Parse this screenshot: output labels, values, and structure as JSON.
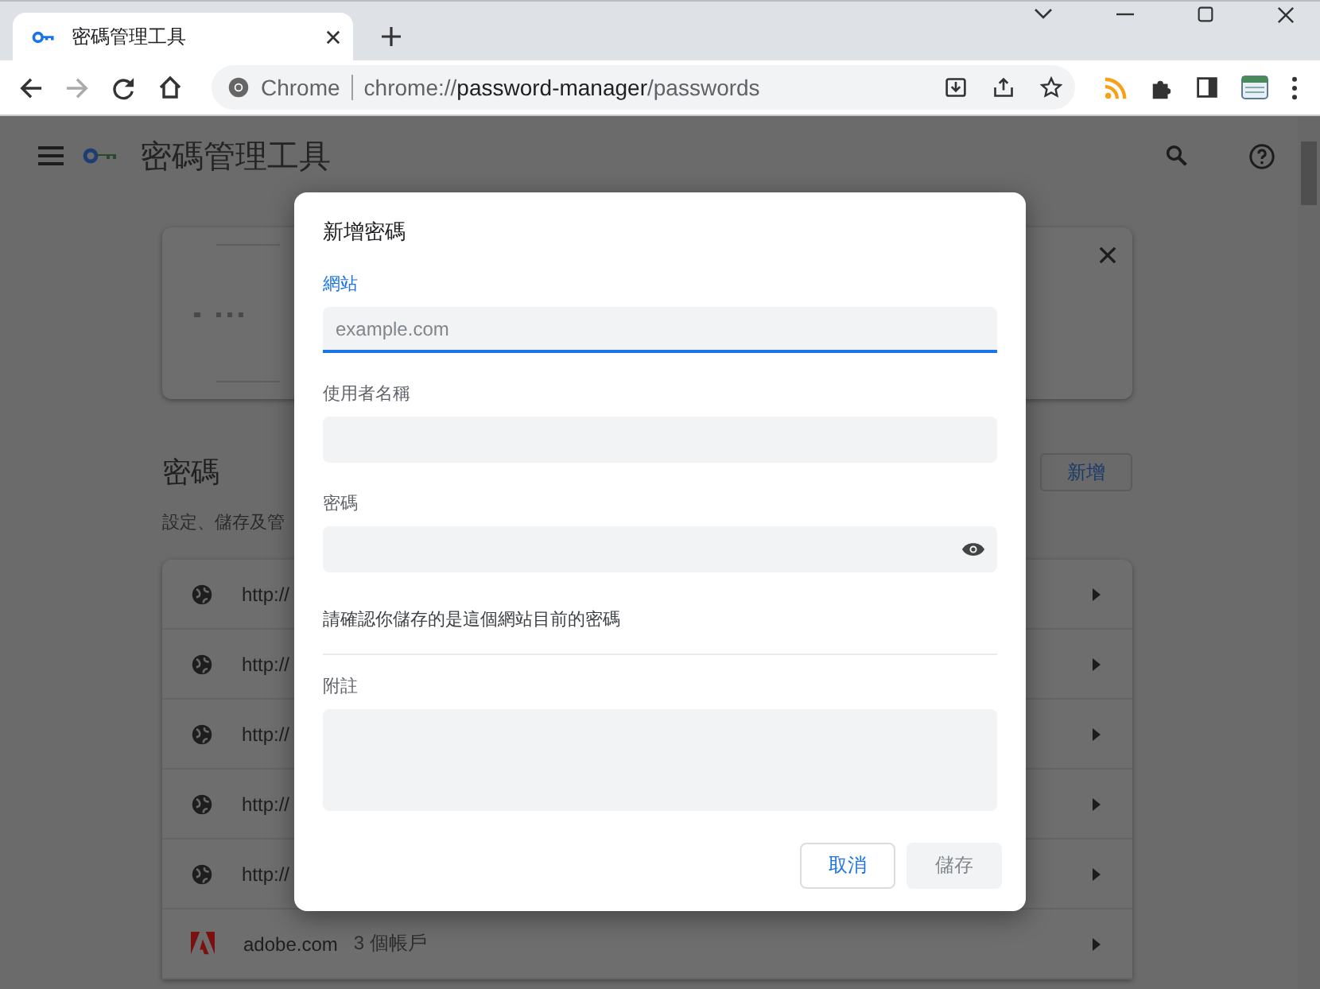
{
  "browser": {
    "tab": {
      "title": "密碼管理工具",
      "selected": true
    },
    "address": {
      "site_label": "Chrome",
      "url": "chrome://**password-manager**/passwords"
    }
  },
  "page": {
    "title": "密碼管理工具",
    "section_title": "密碼",
    "section_subtitle": "設定、儲存及管",
    "add_button": "新增",
    "rows": [
      {
        "kind": "globe",
        "site": "http://"
      },
      {
        "kind": "globe",
        "site": "http://"
      },
      {
        "kind": "globe",
        "site": "http://"
      },
      {
        "kind": "globe",
        "site": "http://"
      },
      {
        "kind": "globe",
        "site": "http://"
      },
      {
        "kind": "logo",
        "site": "adobe.com",
        "count": "3 個帳戶"
      }
    ]
  },
  "dialog": {
    "title": "新增密碼",
    "fields": [
      {
        "kind": "input",
        "label": "網站",
        "placeholder": "example.com",
        "focused": true
      },
      {
        "kind": "input",
        "label": "使用者名稱",
        "focused": false
      },
      {
        "kind": "password",
        "label": "密碼",
        "focused": false,
        "note": "請確認你儲存的是這個網站目前的密碼"
      },
      {
        "kind": "textarea",
        "label": "附註",
        "focused": false
      }
    ],
    "buttons": [
      {
        "label": "取消",
        "disabled": false
      },
      {
        "label": "儲存",
        "disabled": true
      }
    ]
  }
}
